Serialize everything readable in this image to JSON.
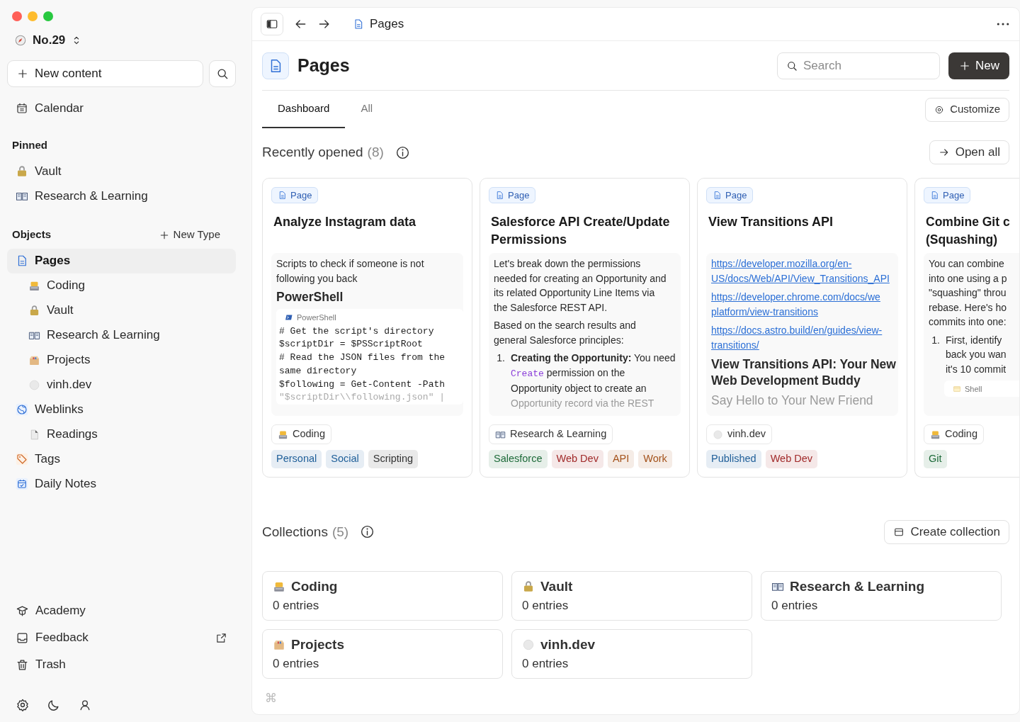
{
  "window": {
    "controls": [
      {
        "color": "#ff5f57"
      },
      {
        "color": "#febc2e"
      },
      {
        "color": "#28c840"
      }
    ]
  },
  "sidebar": {
    "workspace": "No.29",
    "new_content": "New content",
    "calendar": "Calendar",
    "sections": [
      {
        "title": "Pinned",
        "items": [
          {
            "kind": "lock",
            "label": "Vault",
            "selected": false
          },
          {
            "kind": "book",
            "label": "Research & Learning",
            "selected": false
          }
        ]
      },
      {
        "title": "Objects",
        "action": "New Type",
        "items": [
          {
            "kind": "page",
            "label": "Pages",
            "selected": true,
            "children": [
              {
                "kind": "coder",
                "label": "Coding",
                "selected": false
              },
              {
                "kind": "lock",
                "label": "Vault",
                "selected": false
              },
              {
                "kind": "book",
                "label": "Research & Learning",
                "selected": false
              },
              {
                "kind": "box",
                "label": "Projects",
                "selected": false
              },
              {
                "kind": "circle",
                "label": "vinh.dev",
                "selected": false
              }
            ]
          },
          {
            "kind": "globe",
            "label": "Weblinks",
            "selected": false,
            "children": [
              {
                "kind": "file",
                "label": "Readings",
                "selected": false
              }
            ]
          },
          {
            "kind": "tag",
            "label": "Tags",
            "selected": false
          },
          {
            "kind": "daily",
            "label": "Daily Notes",
            "selected": false
          }
        ]
      }
    ],
    "footer": [
      {
        "kind": "academy",
        "label": "Academy",
        "external": false
      },
      {
        "kind": "feedback",
        "label": "Feedback",
        "external": true
      },
      {
        "kind": "trash",
        "label": "Trash",
        "external": false
      }
    ],
    "bottom_icons": [
      {
        "kind": "settings"
      },
      {
        "kind": "moon"
      },
      {
        "kind": "user"
      }
    ]
  },
  "toolbar": {
    "breadcrumb": "Pages"
  },
  "header": {
    "title": "Pages",
    "search": {
      "placeholder": "Search"
    },
    "new_button": "New"
  },
  "tabs": [
    {
      "label": "Dashboard",
      "selected": true
    },
    {
      "label": "All",
      "selected": false
    }
  ],
  "customize": "Customize",
  "recent": {
    "title": "Recently opened",
    "count": "(8)",
    "open_all": "Open all",
    "cards": [
      {
        "type": "Page",
        "title": [
          "Analyze Instagram data"
        ],
        "body": [
          {
            "kind": "text",
            "lines": [
              "Scripts to check if someone is not",
              "following you back"
            ]
          },
          {
            "kind": "heading",
            "lines": [
              "PowerShell"
            ]
          },
          {
            "kind": "code",
            "language": "PowerShell",
            "lines": [
              "# Get the script's directory",
              "$scriptDir = $PSScriptRoot",
              "# Read the JSON files from the",
              "same directory",
              "$following = Get-Content -Path"
            ],
            "faded_lines": [
              "\"$scriptDir\\\\following.json\" |"
            ]
          }
        ],
        "collection": {
          "kind": "coder",
          "label": "Coding"
        },
        "tags": [
          {
            "label": "Personal",
            "color": "#1f5f99"
          },
          {
            "label": "Social",
            "color": "#1f5f99"
          },
          {
            "label": "Scripting",
            "color": "#333333"
          }
        ]
      },
      {
        "type": "Page",
        "title": [
          "Salesforce API Create/Update",
          "Permissions"
        ],
        "body": [
          {
            "kind": "text",
            "lines": [
              "Let's break down the permissions",
              "needed for creating an Opportunity and",
              "its related Opportunity Line Items via",
              "the Salesforce REST API."
            ]
          },
          {
            "kind": "text",
            "lines": [
              "Based on the search results and",
              "general Salesforce principles:"
            ]
          },
          {
            "kind": "list",
            "items": [
              {
                "number": "1.",
                "lines": [
                  [
                    {
                      "kind": "text",
                      "text": "**Creating the Opportunity:** You need"
                    }
                  ],
                  [
                    {
                      "kind": "code",
                      "text": "Create"
                    },
                    {
                      "kind": "text",
                      "text": " permission on the"
                    }
                  ],
                  [
                    {
                      "kind": "text",
                      "text": "Opportunity object to create an"
                    }
                  ],
                  [
                    {
                      "kind": "faded",
                      "text": "Opportunity record via the REST"
                    }
                  ]
                ]
              }
            ]
          }
        ],
        "collection": {
          "kind": "book",
          "label": "Research & Learning"
        },
        "tags": [
          {
            "label": "Salesforce",
            "color": "#1e6b3a"
          },
          {
            "label": "Web Dev",
            "color": "#a12a2a"
          },
          {
            "label": "API",
            "color": "#a4531c"
          },
          {
            "label": "Work",
            "color": "#a4531c"
          }
        ]
      },
      {
        "type": "Page",
        "title": [
          "View Transitions API"
        ],
        "body": [
          {
            "kind": "link",
            "lines": [
              "https://developer.mozilla.org/en-",
              "US/docs/Web/API/View_Transitions_API"
            ]
          },
          {
            "kind": "link",
            "lines": [
              "https://developer.chrome.com/docs/we",
              "platform/view-transitions"
            ]
          },
          {
            "kind": "link",
            "lines": [
              "https://docs.astro.build/en/guides/view-",
              "transitions/"
            ]
          },
          {
            "kind": "heading",
            "lines": [
              "View Transitions API: Your New",
              "Web Development Buddy"
            ],
            "faded_lines": [
              "Say Hello to Your New Friend"
            ]
          }
        ],
        "collection": {
          "kind": "circle",
          "label": "vinh.dev"
        },
        "tags": [
          {
            "label": "Published",
            "color": "#1f5f99"
          },
          {
            "label": "Web Dev",
            "color": "#a12a2a"
          }
        ]
      },
      {
        "type": "Page",
        "title": [
          "Combine Git c",
          "(Squashing)"
        ],
        "body": [
          {
            "kind": "text",
            "lines": [
              "You can combine",
              "into one using a p",
              "\"squashing\" throu",
              "rebase. Here's ho",
              "commits into one:"
            ]
          },
          {
            "kind": "list",
            "items": [
              {
                "number": "1.",
                "lines": [
                  [
                    {
                      "kind": "text",
                      "text": "First, identify"
                    }
                  ],
                  [
                    {
                      "kind": "text",
                      "text": "back you wan"
                    }
                  ],
                  [
                    {
                      "kind": "text",
                      "text": "it's 10 commit"
                    }
                  ]
                ]
              }
            ]
          },
          {
            "kind": "code",
            "language": "Shell"
          }
        ],
        "collection": {
          "kind": "coder",
          "label": "Coding"
        },
        "tags": [
          {
            "label": "Git",
            "color": "#1e6b3a"
          }
        ]
      }
    ]
  },
  "collections": {
    "title": "Collections",
    "count": "(5)",
    "create": "Create collection",
    "items": [
      {
        "kind": "coder",
        "name": "Coding",
        "entries": "0 entries"
      },
      {
        "kind": "lock",
        "name": "Vault",
        "entries": "0 entries"
      },
      {
        "kind": "book",
        "name": "Research & Learning",
        "entries": "0 entries"
      },
      {
        "kind": "box",
        "name": "Projects",
        "entries": "0 entries"
      },
      {
        "kind": "circle",
        "name": "vinh.dev",
        "entries": "0 entries"
      }
    ]
  },
  "shortcut_hint": "⌘"
}
